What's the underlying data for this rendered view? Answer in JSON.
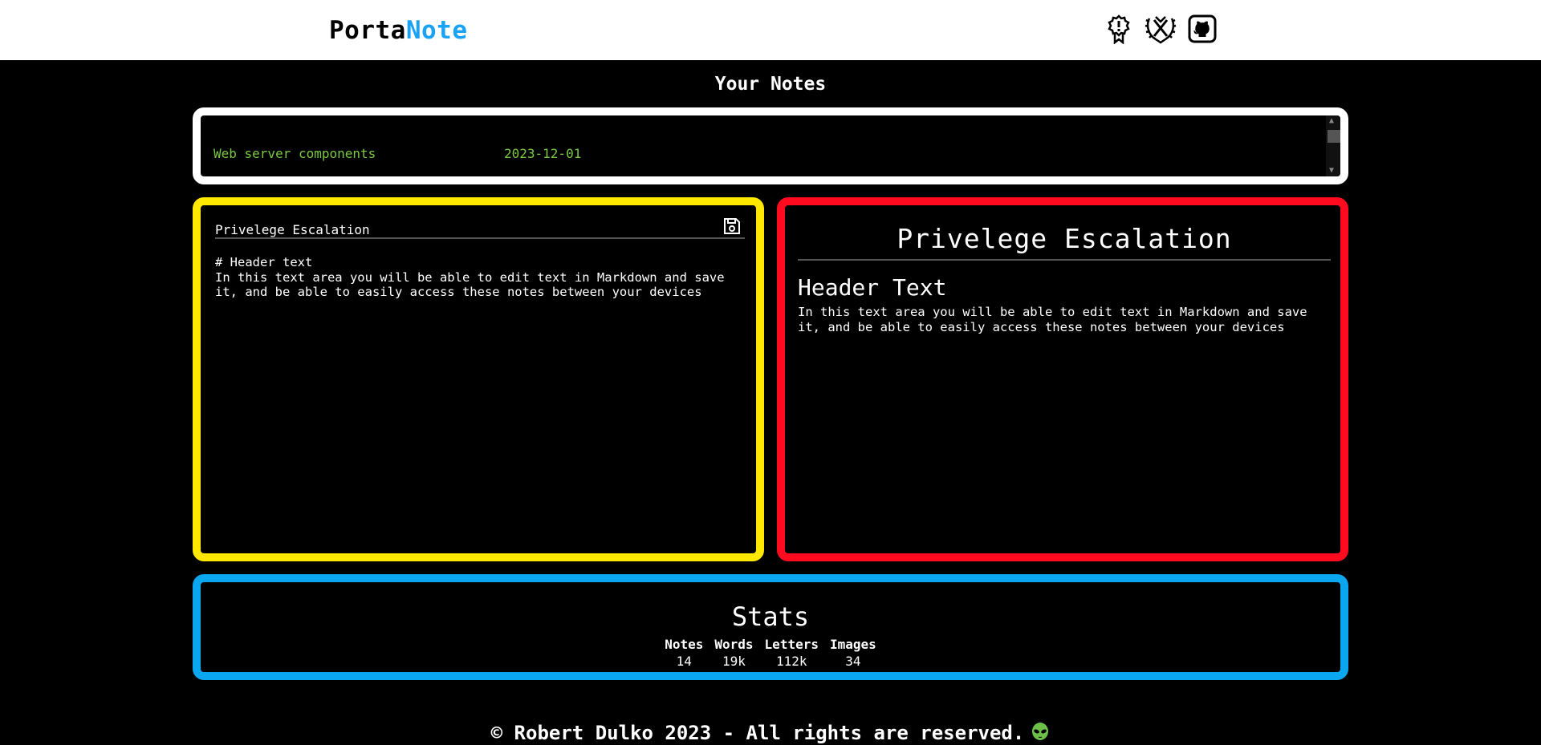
{
  "header": {
    "brand_part1": "Porta",
    "brand_part2": "Note",
    "icons": [
      "award-icon",
      "laurel-trophy-icon",
      "github-icon"
    ]
  },
  "notes_section": {
    "title": "Your Notes",
    "notes": [
      {
        "title": "Web server components",
        "date": "2023-12-01"
      }
    ]
  },
  "editor": {
    "title": "Privelege Escalation",
    "content": "# Header text\nIn this text area you will be able to edit text in Markdown and save it, and be able to easily access these notes between your devices"
  },
  "preview": {
    "title": "Privelege Escalation",
    "heading": "Header Text",
    "paragraph": "In this text area you will be able to edit text in Markdown and save it, and be able to easily access these notes between your devices"
  },
  "stats": {
    "title": "Stats",
    "items": [
      {
        "label": "Notes",
        "value": "14"
      },
      {
        "label": "Words",
        "value": "19k"
      },
      {
        "label": "Letters",
        "value": "112k"
      },
      {
        "label": "Images",
        "value": "34"
      }
    ]
  },
  "footer": {
    "text": "© Robert Dulko 2023 - All rights are reserved."
  },
  "colors": {
    "brand_accent": "#1aa3f5",
    "notes_border": "#ffffff",
    "editor_border": "#ffe800",
    "preview_border": "#ff0a1e",
    "stats_border": "#0aa6f0",
    "note_text": "#7ac943"
  }
}
